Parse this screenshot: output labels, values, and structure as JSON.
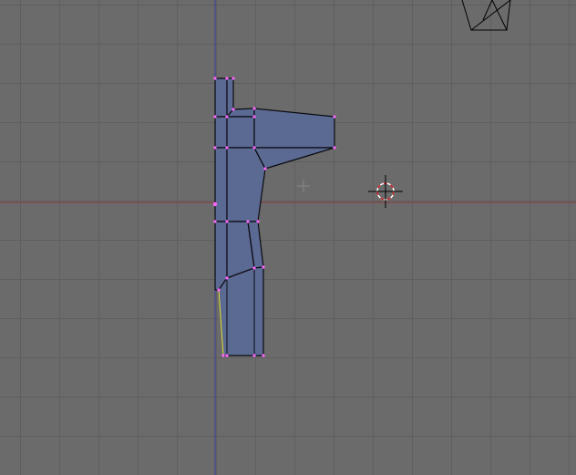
{
  "viewport": {
    "label": "",
    "colors": {
      "background": "#6b6b6b",
      "grid": "#5f5f5f",
      "x_axis": "#8c3b3b",
      "y_axis": "#3b3b9b",
      "mesh_face": "#5b6a92",
      "mesh_edge": "#0b0b12",
      "vertex": "#ff66ff",
      "cursor_red": "#cc2222",
      "cursor_white": "#ffffff",
      "camera": "#000000",
      "selected_edge": "#d8d84a"
    },
    "icons": [
      "3d-cursor-icon",
      "camera-icon",
      "object-center-icon"
    ]
  }
}
